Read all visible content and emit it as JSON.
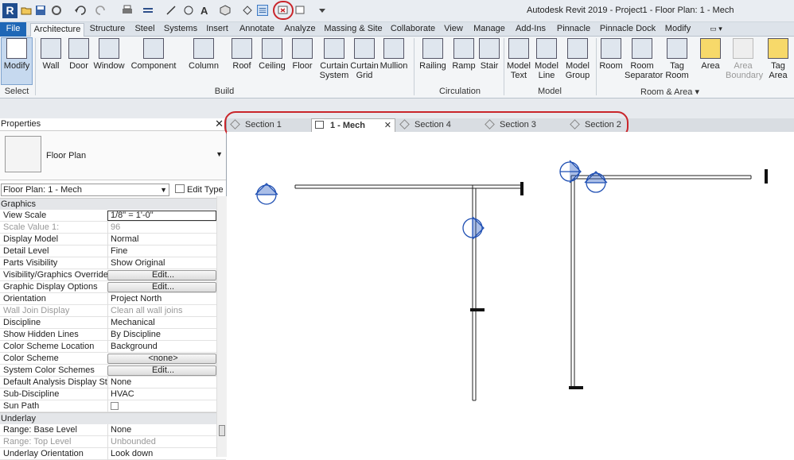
{
  "app": {
    "title": "Autodesk Revit 2019 - Project1 - Floor Plan: 1 - Mech",
    "logo": "R"
  },
  "quick_access": [
    "open-icon",
    "save-icon",
    "sync-icon",
    "undo-icon",
    "redo-icon",
    "print-icon",
    "measure-icon",
    "align-dimension-icon",
    "tag-icon",
    "text-icon",
    "3d-view-icon",
    "section-icon",
    "thin-lines-icon",
    "close-hidden-windows-icon",
    "switch-windows-icon",
    "customize-icon"
  ],
  "ribbon_tabs": [
    "File",
    "Architecture",
    "Structure",
    "Steel",
    "Systems",
    "Insert",
    "Annotate",
    "Analyze",
    "Massing & Site",
    "Collaborate",
    "View",
    "Manage",
    "Add-Ins",
    "Pinnacle",
    "Pinnacle Dock",
    "Modify"
  ],
  "active_tab": "Architecture",
  "tools": {
    "modify": "Modify",
    "select": "Select",
    "wall": "Wall",
    "door": "Door",
    "window": "Window",
    "component": "Component",
    "column": "Column",
    "roof": "Roof",
    "ceiling": "Ceiling",
    "floor": "Floor",
    "curtain_system": "Curtain System",
    "curtain_grid": "Curtain Grid",
    "mullion": "Mullion",
    "railing": "Railing",
    "ramp": "Ramp",
    "stair": "Stair",
    "model_text": "Model Text",
    "model_line": "Model Line",
    "model_group": "Model Group",
    "room": "Room",
    "room_separator": "Room Separator",
    "tag_room": "Tag Room",
    "area": "Area",
    "area_boundary": "Area Boundary",
    "tag_area": "Tag Area"
  },
  "panels": {
    "build": "Build",
    "circulation": "Circulation",
    "model": "Model",
    "room_area": "Room & Area"
  },
  "properties": {
    "header": "Properties",
    "type_name": "Floor Plan",
    "selector": "Floor Plan: 1 - Mech",
    "edit_type": "Edit Type",
    "graphics_cat": "Graphics",
    "underlay_cat": "Underlay",
    "rows": [
      {
        "k": "View Scale",
        "v": "1/8\" = 1'-0\""
      },
      {
        "k": "Scale Value    1:",
        "v": "96"
      },
      {
        "k": "Display Model",
        "v": "Normal"
      },
      {
        "k": "Detail Level",
        "v": "Fine"
      },
      {
        "k": "Parts Visibility",
        "v": "Show Original"
      },
      {
        "k": "Visibility/Graphics Overrides",
        "v": "Edit..."
      },
      {
        "k": "Graphic Display Options",
        "v": "Edit..."
      },
      {
        "k": "Orientation",
        "v": "Project North"
      },
      {
        "k": "Wall Join Display",
        "v": "Clean all wall joins"
      },
      {
        "k": "Discipline",
        "v": "Mechanical"
      },
      {
        "k": "Show Hidden Lines",
        "v": "By Discipline"
      },
      {
        "k": "Color Scheme Location",
        "v": "Background"
      },
      {
        "k": "Color Scheme",
        "v": "<none>"
      },
      {
        "k": "System Color Schemes",
        "v": "Edit..."
      },
      {
        "k": "Default Analysis Display Style",
        "v": "None"
      },
      {
        "k": "Sub-Discipline",
        "v": "HVAC"
      },
      {
        "k": "Sun Path",
        "v": ""
      }
    ],
    "underlay_rows": [
      {
        "k": "Range: Base Level",
        "v": "None"
      },
      {
        "k": "Range: Top Level",
        "v": "Unbounded"
      },
      {
        "k": "Underlay Orientation",
        "v": "Look down"
      }
    ]
  },
  "view_tabs": [
    "Section 1",
    "1 - Mech",
    "Section 4",
    "Section 3",
    "Section 2"
  ],
  "active_view_tab": "1 - Mech"
}
